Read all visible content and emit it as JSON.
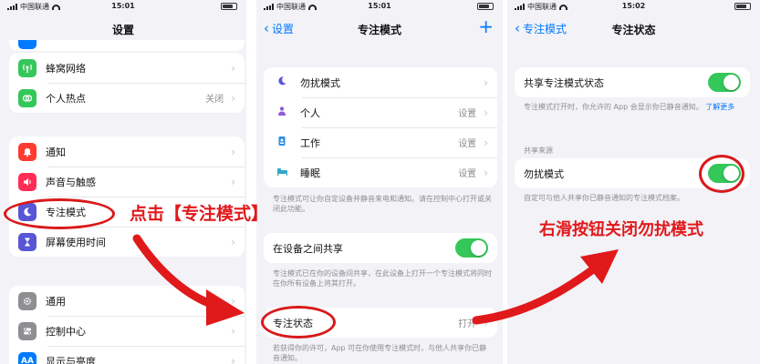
{
  "status_bar": {
    "carrier": "中国联通",
    "times": [
      "15:01",
      "15:01",
      "15:02"
    ]
  },
  "screen1": {
    "title": "设置",
    "group1": [
      {
        "label": "蜂窝网络",
        "value": "",
        "icon": "antenna-icon",
        "color": "#34c759"
      },
      {
        "label": "个人热点",
        "value": "关闭",
        "icon": "hotspot-icon",
        "color": "#34c759"
      }
    ],
    "group2": [
      {
        "label": "通知",
        "icon": "bell-icon",
        "color": "#ff3b30"
      },
      {
        "label": "声音与触感",
        "icon": "speaker-icon",
        "color": "#ff2d55"
      },
      {
        "label": "专注模式",
        "icon": "moon-icon",
        "color": "#5856d6"
      },
      {
        "label": "屏幕使用时间",
        "icon": "hourglass-icon",
        "color": "#5856d6"
      }
    ],
    "group3": [
      {
        "label": "通用",
        "icon": "gear-icon",
        "color": "#8e8e93"
      },
      {
        "label": "控制中心",
        "icon": "switches-icon",
        "color": "#8e8e93"
      },
      {
        "label": "显示与亮度",
        "icon": "display-icon",
        "color": "#007aff"
      }
    ]
  },
  "screen2": {
    "back": "设置",
    "title": "专注模式",
    "add": "+",
    "modes": [
      {
        "label": "勿扰模式",
        "value": "",
        "icon": "moon-icon",
        "color": "#5856d6"
      },
      {
        "label": "个人",
        "value": "设置",
        "icon": "person-icon",
        "color": "#8e5cd6"
      },
      {
        "label": "工作",
        "value": "设置",
        "icon": "badge-icon",
        "color": "#2c8ee8"
      },
      {
        "label": "睡眠",
        "value": "设置",
        "icon": "bed-icon",
        "color": "#30a7c8"
      }
    ],
    "modes_note": "专注模式可让你自定设备并静音来电和通知。请在控制中心打开或关闭此功能。",
    "share_label": "在设备之间共享",
    "share_note": "专注模式已在你的设备间共享，在此设备上打开一个专注模式将同时在你所有设备上将其打开。",
    "status_label": "专注状态",
    "status_value": "打开",
    "status_note": "若获得你的许可，App 可在你使用专注模式时，与他人共享你已静音通知。"
  },
  "screen3": {
    "back": "专注模式",
    "title": "专注状态",
    "share_label": "共享专注模式状态",
    "share_note": "专注模式打开时，你允许的 App 会显示你已静音通知。",
    "learn_more": "了解更多",
    "section_header": "共享来源",
    "dnd_label": "勿扰模式",
    "dnd_note": "自定可与他人共享你已静音通知的专注模式档案。"
  },
  "annotations": {
    "tap_focus": "点击【专注模式】",
    "swipe_off": "右滑按钮关闭勿扰模式"
  },
  "colors": {
    "accent": "#007aff",
    "toggle_on": "#34c759",
    "annotation": "#e0191b"
  }
}
